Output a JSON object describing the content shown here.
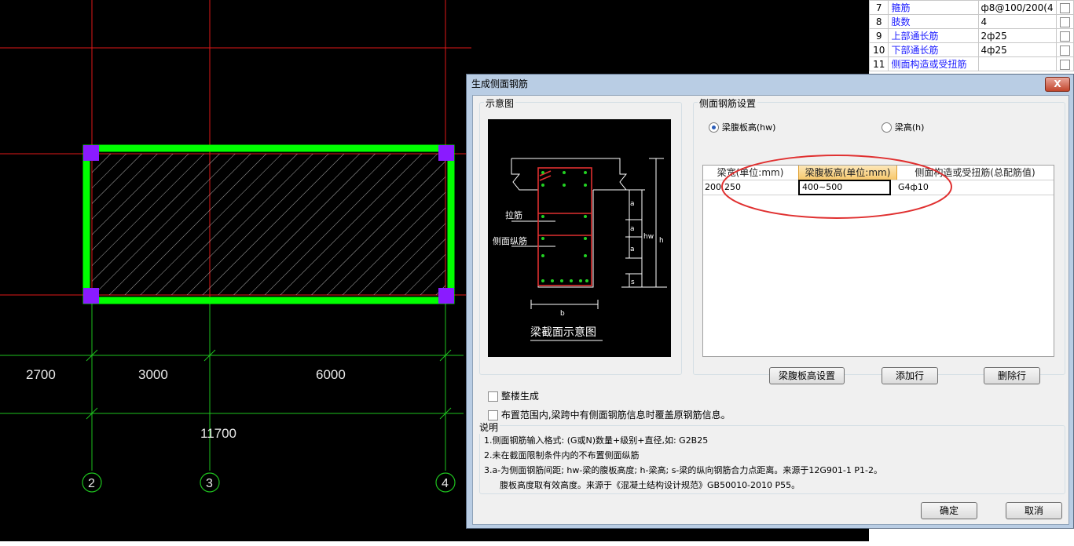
{
  "cad": {
    "dimensions": [
      "2700",
      "3000",
      "6000"
    ],
    "total_dimension": "11700",
    "axes": [
      "2",
      "3",
      "4"
    ]
  },
  "props": {
    "rows": [
      {
        "num": "7",
        "name": "箍筋",
        "value": "ф8@100/200(4"
      },
      {
        "num": "8",
        "name": "肢数",
        "value": "4"
      },
      {
        "num": "9",
        "name": "上部通长筋",
        "value": "2ф25"
      },
      {
        "num": "10",
        "name": "下部通长筋",
        "value": "4ф25"
      },
      {
        "num": "11",
        "name": "侧面构造或受扭筋",
        "value": ""
      }
    ]
  },
  "dialog": {
    "title": "生成侧面钢筋",
    "close_label": "X",
    "diagram_group": "示意图",
    "diagram": {
      "label_tie": "拉筋",
      "label_side": "侧面纵筋",
      "label_a": "a",
      "label_hw": "hw",
      "label_h": "h",
      "label_s": "s",
      "label_b": "b",
      "caption": "梁截面示意图"
    },
    "settings_group": "侧面钢筋设置",
    "radio_hw": "梁腹板高(hw)",
    "radio_h": "梁高(h)",
    "grid": {
      "headers": [
        "梁宽(单位:mm)",
        "梁腹板高(单位:mm)",
        "侧面构造或受扭筋(总配筋值)"
      ],
      "row": {
        "width_a": "200",
        "width_b": "250",
        "hw": "400~500",
        "rebar": "G4ф10"
      }
    },
    "btn_hw_setting": "梁腹板高设置",
    "btn_add_row": "添加行",
    "btn_delete_row": "删除行",
    "chk_whole_floor": "整楼生成",
    "chk_override": "布置范围内,梁跨中有侧面钢筋信息时覆盖原钢筋信息。",
    "notes_title": "说明",
    "notes": [
      "1.侧面钢筋输入格式: (G或N)数量+级别+直径,如: G2B25",
      "2.未在截面限制条件内的不布置侧面纵筋",
      "3.a-为侧面钢筋间距; hw-梁的腹板高度; h-梁高; s-梁的纵向钢筋合力点距离。来源于12G901-1 P1-2。",
      "腹板高度取有效高度。来源于《混凝土结构设计规范》GB50010-2010 P55。"
    ],
    "btn_ok": "确定",
    "btn_cancel": "取消"
  },
  "colors": {
    "grid_red": "#e01818",
    "beam_green": "#00ff00",
    "column_purple": "#8a1bff",
    "dim_green": "#1ec21e",
    "annotation_red": "#e03030"
  }
}
